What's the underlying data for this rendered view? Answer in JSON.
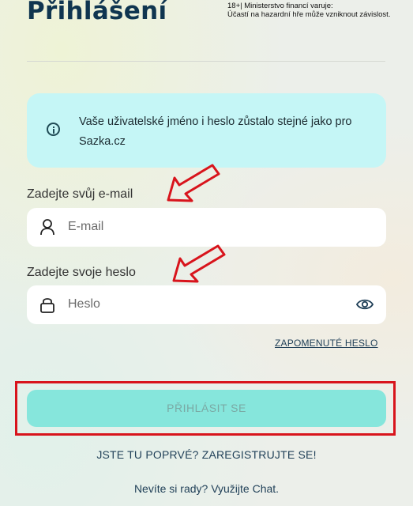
{
  "header": {
    "title": "Přihlášení",
    "warning_line1": "18+| Ministerstvo financí varuje:",
    "warning_line2": "Účastí na hazardní hře může vzniknout závislost."
  },
  "info": {
    "icon": "info-icon",
    "text": "Vaše uživatelské jméno i heslo zůstalo stejné jako pro Sazka.cz"
  },
  "email": {
    "label": "Zadejte svůj e-mail",
    "placeholder": "E-mail",
    "icon": "user-icon"
  },
  "password": {
    "label": "Zadejte svoje heslo",
    "placeholder": "Heslo",
    "icon": "lock-icon",
    "toggle_icon": "eye-icon"
  },
  "links": {
    "forgot_password": "ZAPOMENUTÉ HESLO",
    "register": "JSTE TU POPRVÉ? ZAREGISTRUJTE SE!",
    "help": "Nevíte si rady? Využijte Chat."
  },
  "buttons": {
    "login": "PŘIHLÁSIT SE"
  },
  "colors": {
    "brand_dark": "#0f3550",
    "info_bg": "#c5f6f6",
    "login_btn": "#86e6dc",
    "annotation_red": "#d8141c"
  }
}
